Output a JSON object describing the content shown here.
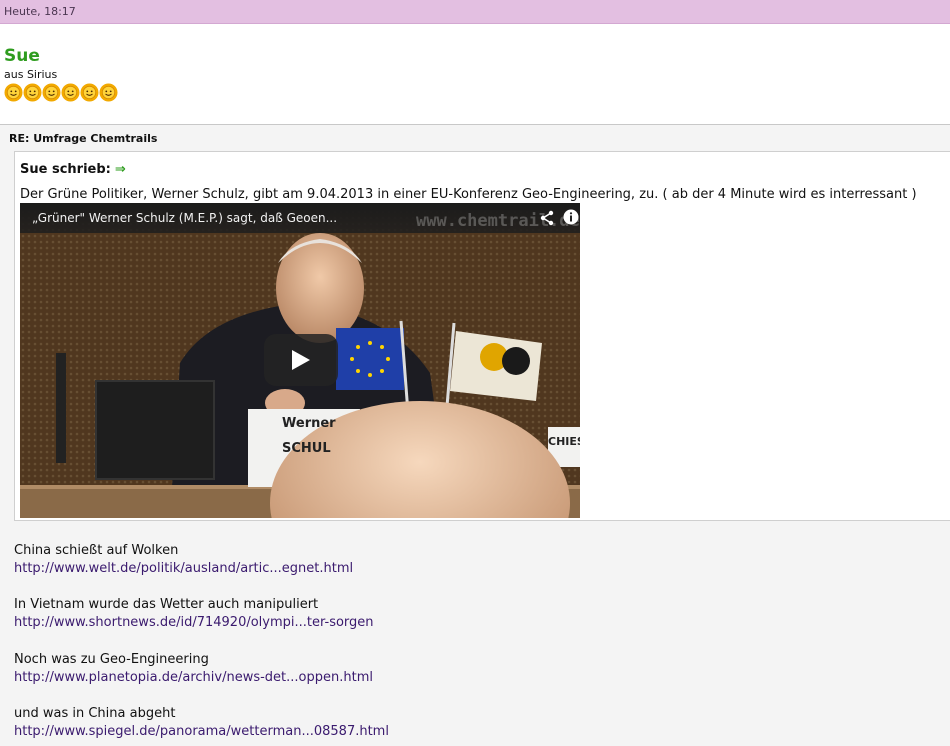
{
  "header": {
    "timestamp": "Heute, 18:17"
  },
  "author": {
    "name": "Sue",
    "origin": "aus Sirius",
    "rank_smileys": 6
  },
  "post": {
    "subject": "RE: Umfrage Chemtrails",
    "quote": {
      "author_label": "Sue schrieb:",
      "arrow": "⇒",
      "text": "Der Grüne Politiker, Werner Schulz, gibt am 9.04.2013 in einer EU-Konferenz Geo-Engineering, zu. ( ab der 4 Minute wird es interressant )",
      "video": {
        "title": "„Grüner\" Werner Schulz (M.E.P.) sagt, daß Geoen...",
        "watermark": "www.chemtrail.de",
        "nameplate_line1": "Werner",
        "nameplate_line2": "SCHUL",
        "side_label": "CHIES"
      }
    },
    "paragraphs": [
      {
        "text": "China schießt auf Wolken",
        "link": "http://www.welt.de/politik/ausland/artic...egnet.html"
      },
      {
        "text": "In Vietnam wurde das Wetter auch manipuliert",
        "link": "http://www.shortnews.de/id/714920/olympi...ter-sorgen"
      },
      {
        "text": "Noch was zu Geo-Engineering",
        "link": "http://www.planetopia.de/archiv/news-det...oppen.html"
      },
      {
        "text": "und was in China abgeht",
        "link": "http://www.spiegel.de/panorama/wetterman...08587.html"
      }
    ]
  },
  "colors": {
    "header_bg": "#e3bfe1",
    "author_name": "#2e9c1e",
    "link": "#3a1a6e",
    "post_bg": "#f4f4f4"
  }
}
